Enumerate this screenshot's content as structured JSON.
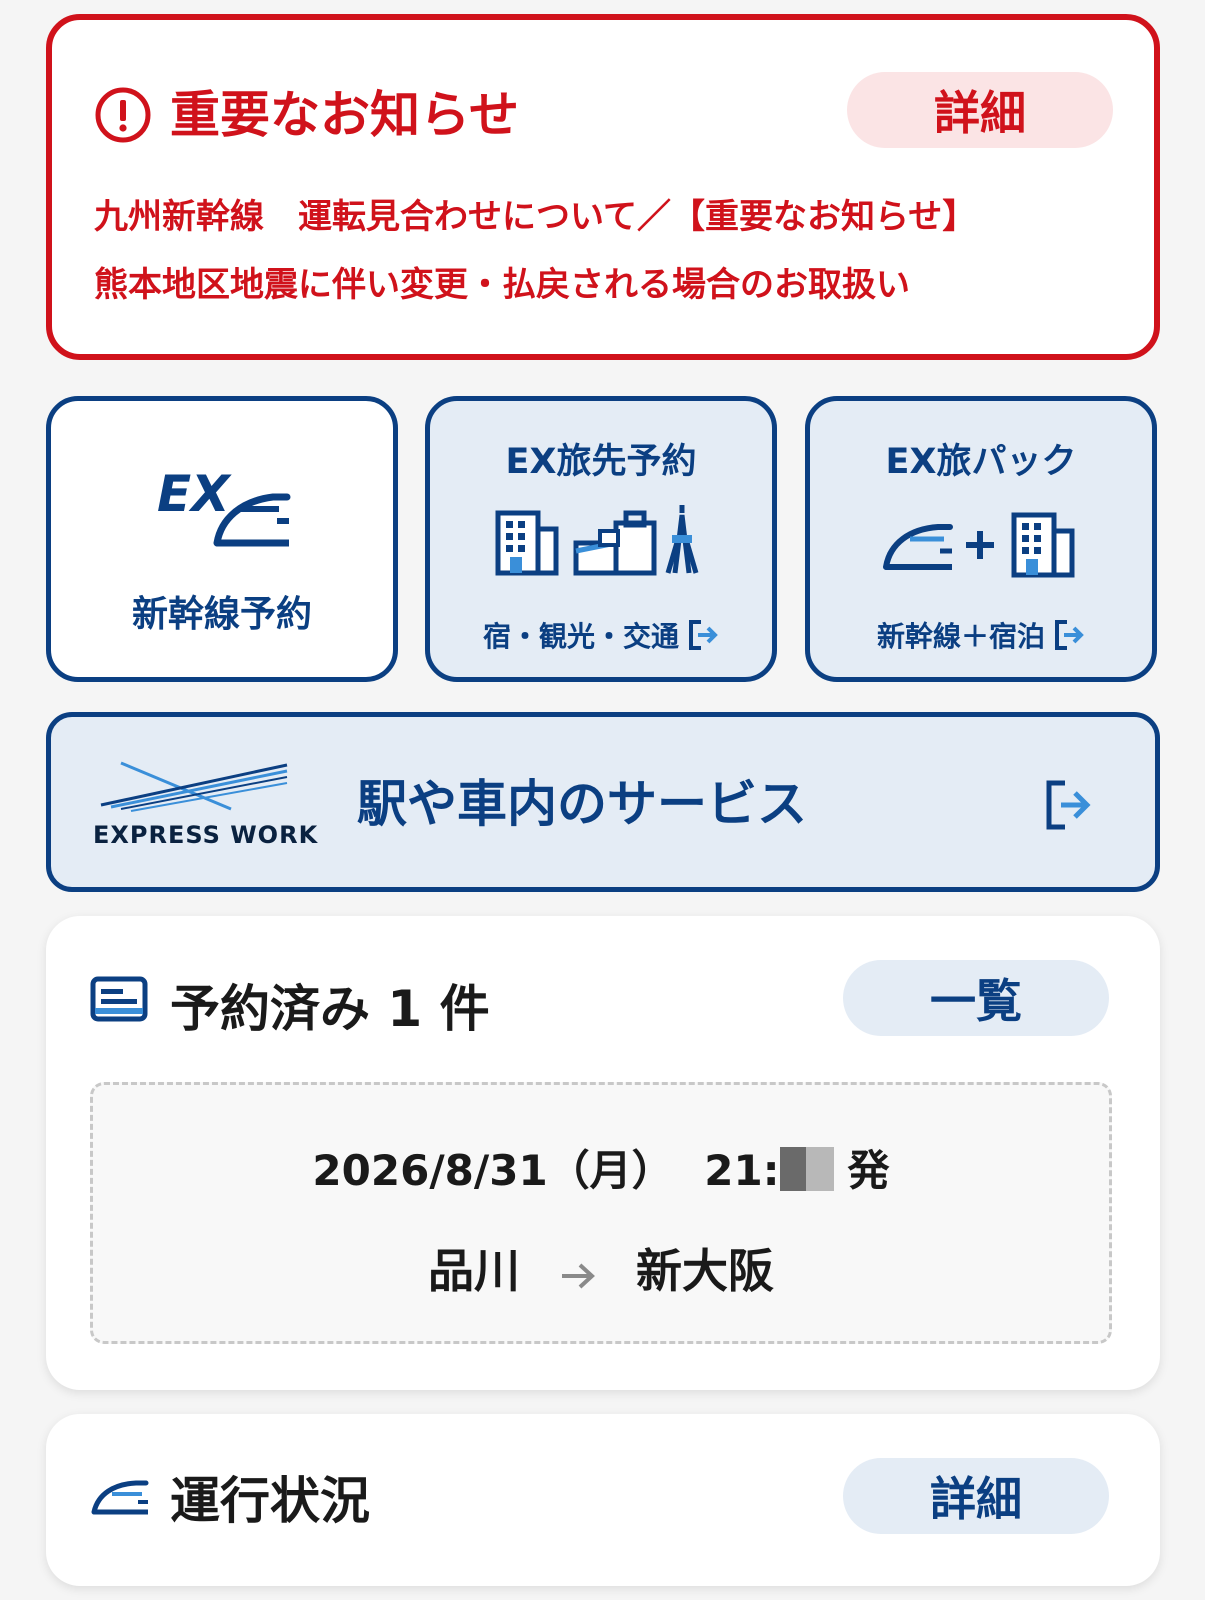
{
  "notice": {
    "title": "重要なお知らせ",
    "detail_label": "詳細",
    "line1": "九州新幹線　運転見合わせについて／【重要なお知らせ】",
    "line2": "熊本地区地震に伴い変更・払戻される場合のお取扱い",
    "color": "#d0121b"
  },
  "tiles": {
    "ex": {
      "logo_text": "EX",
      "label": "新幹線予約"
    },
    "tabisaki": {
      "title": "EX旅先予約",
      "sub": "宿・観光・交通"
    },
    "tabipack": {
      "title": "EX旅パック",
      "sub": "新幹線＋宿泊"
    }
  },
  "service": {
    "logo_text": "EXPRESS WORK",
    "title": "駅や車内のサービス"
  },
  "reservation": {
    "title": "予約済み 1 件",
    "list_label": "一覧",
    "date": "2026/8/31（月）",
    "time_prefix": "21:",
    "departure_suffix": "発",
    "from": "品川",
    "to": "新大阪"
  },
  "operation": {
    "title": "運行状況",
    "detail_label": "詳細"
  },
  "colors": {
    "brand_blue": "#0b3f82",
    "alert_red": "#d0121b",
    "tile_bg": "#e4ecf5"
  }
}
